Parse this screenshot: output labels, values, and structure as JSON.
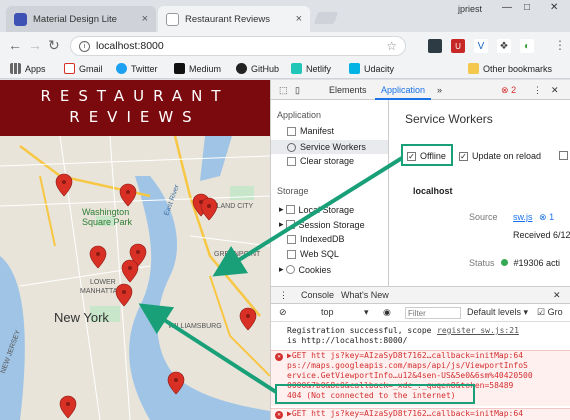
{
  "browser": {
    "tabs": [
      {
        "title": "Material Design Lite",
        "close": "×"
      },
      {
        "title": "Restaurant Reviews",
        "close": "×"
      }
    ],
    "profile": "jpriest",
    "window_controls": [
      "—",
      "□",
      "✕"
    ],
    "url": "localhost:8000",
    "bookmarks": [
      "Apps",
      "Gmail",
      "Twitter",
      "Medium",
      "GitHub",
      "Netlify",
      "Udacity",
      "Other bookmarks"
    ]
  },
  "page": {
    "title_line1": "RESTAURANT",
    "title_line2": "REVIEWS",
    "map_labels": {
      "washington": "Washington",
      "square_park": "Square Park",
      "lower": "LOWER",
      "manhattan": "MANHATTAN",
      "new_york": "New York",
      "island_city": "ISLAND CITY",
      "greenpoint": "GREENPOINT",
      "williamsburg": "WILLIAMSBURG",
      "new_jersey": "NEW JERSEY",
      "east_river": "East River"
    }
  },
  "devtools": {
    "tabs": [
      "Elements",
      "Application"
    ],
    "error_count": "2",
    "sidebar": {
      "application_header": "Application",
      "application_items": [
        "Manifest",
        "Service Workers",
        "Clear storage"
      ],
      "storage_header": "Storage",
      "storage_items": [
        "Local Storage",
        "Session Storage",
        "IndexedDB",
        "Web SQL",
        "Cookies"
      ]
    },
    "service_workers": {
      "title": "Service Workers",
      "offline_label": "Offline",
      "update_on_reload_label": "Update on reload",
      "origin": "localhost",
      "source_label": "Source",
      "source_value": "sw.js",
      "source_suffix": "1",
      "received_value": "Received 6/12,",
      "status_label": "Status",
      "status_value": "#19306 acti"
    },
    "console": {
      "tabs": [
        "Console",
        "What's New"
      ],
      "context": "top",
      "filter_placeholder": "Filter",
      "levels": "Default levels",
      "groups": "Gro",
      "messages": [
        {
          "type": "log",
          "text": "Registration successful, scope",
          "link": "register_sw.js:21",
          "text2": "is http://localhost:8000/"
        },
        {
          "type": "error",
          "lines": [
            "▶GET htt js?key=AIzaSyD8t7162…callback=initMap:64",
            "ps://maps.googleapis.com/maps/api/js/ViewportInfoS",
            "ervice.GetViewportInfo…u12&4sen-US&5e0&6sm%40420500",
            "0000&7b0&8e0&callback=_xdc_._quqen8&token=58489",
            "404 (Not connected to the internet)"
          ]
        },
        {
          "type": "error",
          "lines": [
            "▶GET htt js?key=AIzaSyD8t7162…callback=initMap:64"
          ]
        }
      ]
    }
  },
  "colors": {
    "header_red": "#7a0a0e",
    "highlight_green": "#19a078",
    "accent_blue": "#1a73e8",
    "error_red": "#d32f2f",
    "pin_red": "#d93025"
  }
}
